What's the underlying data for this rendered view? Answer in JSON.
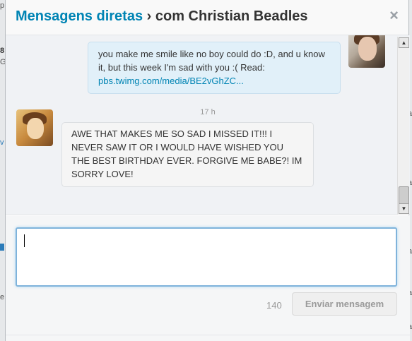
{
  "background_page": {
    "left_fragments": [
      "p",
      "8",
      "G",
      "v",
      "e"
    ],
    "right_fragments": [
      "a",
      "a",
      "a",
      "a",
      "a"
    ]
  },
  "header": {
    "title_link": "Mensagens diretas",
    "separator": "›",
    "subtitle": "com Christian Beadles",
    "close_glyph": "×"
  },
  "conversation": {
    "messages": [
      {
        "direction": "sent",
        "text": "you make me smile like no boy could do :D, and u know it, but this week I'm sad with you :( Read:",
        "link": "pbs.twimg.com/media/BE2vGhZC..."
      },
      {
        "direction": "received",
        "timestamp": "17 h",
        "text": "AWE THAT MAKES ME SO SAD I MISSED IT!!! I NEVER SAW IT OR I WOULD HAVE WISHED YOU THE BEST BIRTHDAY EVER. FORGIVE ME BABE?! IM SORRY LOVE!"
      }
    ]
  },
  "scrollbar": {
    "up_glyph": "▲",
    "down_glyph": "▼"
  },
  "composer": {
    "value": "",
    "char_count": "140",
    "send_label": "Enviar mensagem"
  },
  "colors": {
    "link": "#0084b4",
    "sent_bubble": "#e1f0f9",
    "received_bubble": "#f5f5f5",
    "focus_border": "#7fb3db"
  }
}
